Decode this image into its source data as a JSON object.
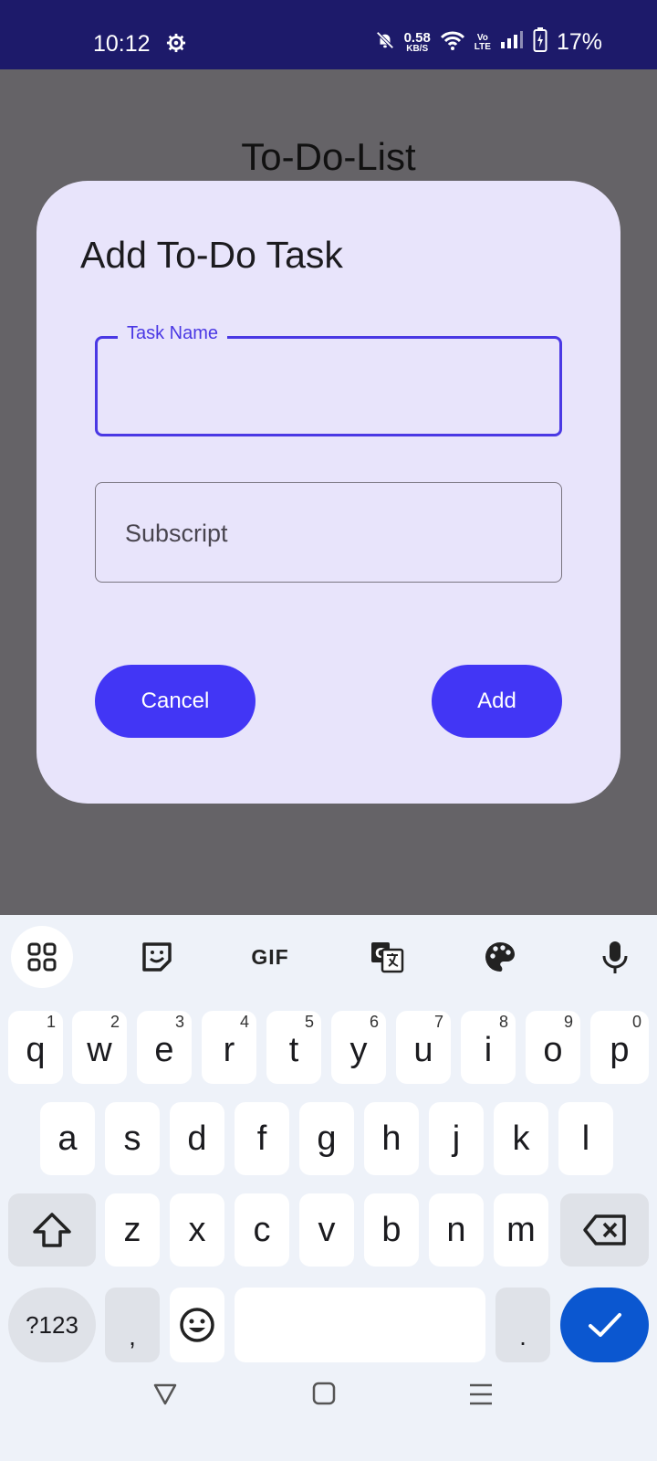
{
  "status_bar": {
    "time": "10:12",
    "net_speed_value": "0.58",
    "net_speed_unit": "KB/S",
    "lte_top": "Vo",
    "lte_bottom": "LTE",
    "battery_percent": "17%"
  },
  "app": {
    "title": "To-Do-List"
  },
  "dialog": {
    "title": "Add To-Do Task",
    "task_field": {
      "label": "Task Name",
      "value": ""
    },
    "subscript_field": {
      "placeholder": "Subscript",
      "value": ""
    },
    "cancel_label": "Cancel",
    "add_label": "Add",
    "accent_color": "#4236f5"
  },
  "keyboard": {
    "toolbar": [
      {
        "name": "apps-grid-icon"
      },
      {
        "name": "sticker-icon"
      },
      {
        "name": "gif-icon",
        "label": "GIF"
      },
      {
        "name": "translate-icon"
      },
      {
        "name": "palette-icon"
      },
      {
        "name": "microphone-icon"
      }
    ],
    "row1": [
      {
        "key": "q",
        "hint": "1"
      },
      {
        "key": "w",
        "hint": "2"
      },
      {
        "key": "e",
        "hint": "3"
      },
      {
        "key": "r",
        "hint": "4"
      },
      {
        "key": "t",
        "hint": "5"
      },
      {
        "key": "y",
        "hint": "6"
      },
      {
        "key": "u",
        "hint": "7"
      },
      {
        "key": "i",
        "hint": "8"
      },
      {
        "key": "o",
        "hint": "9"
      },
      {
        "key": "p",
        "hint": "0"
      }
    ],
    "row2": [
      "a",
      "s",
      "d",
      "f",
      "g",
      "h",
      "j",
      "k",
      "l"
    ],
    "row3": [
      "z",
      "x",
      "c",
      "v",
      "b",
      "n",
      "m"
    ],
    "symbols_label": "?123",
    "comma_label": ",",
    "period_label": ".",
    "enter_color": "#0b57d0"
  },
  "nav_bar": {
    "buttons": [
      "back-icon",
      "home-icon",
      "recents-icon"
    ]
  }
}
